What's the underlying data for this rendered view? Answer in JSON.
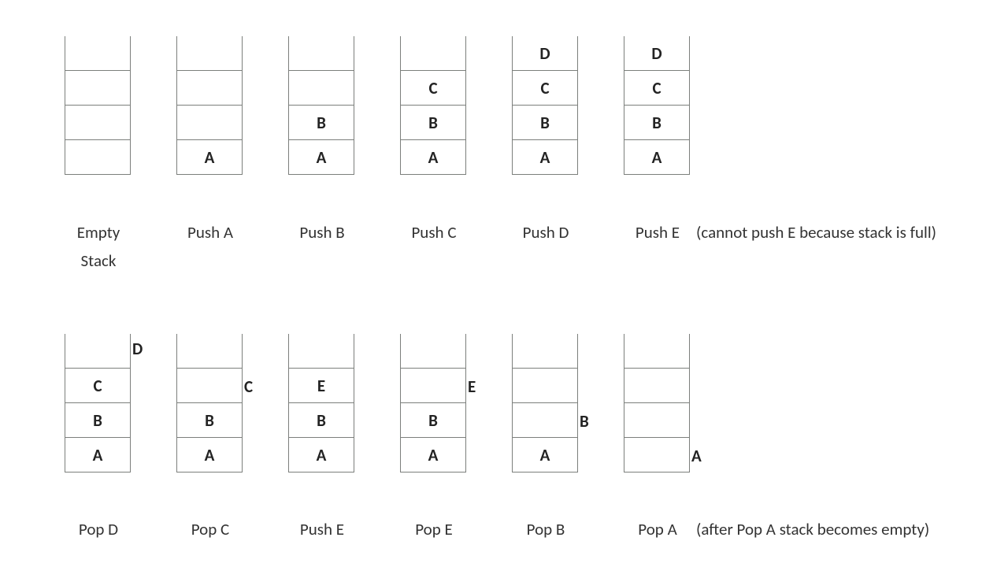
{
  "capacity": 4,
  "top_row": [
    {
      "label": "Empty Stack",
      "values": [
        "",
        "",
        "",
        ""
      ],
      "popped": null
    },
    {
      "label": "Push A",
      "values": [
        "",
        "",
        "",
        "A"
      ],
      "popped": null
    },
    {
      "label": "Push B",
      "values": [
        "",
        "",
        "B",
        "A"
      ],
      "popped": null
    },
    {
      "label": "Push C",
      "values": [
        "",
        "C",
        "B",
        "A"
      ],
      "popped": null
    },
    {
      "label": "Push D",
      "values": [
        "D",
        "C",
        "B",
        "A"
      ],
      "popped": null
    },
    {
      "label": "Push E",
      "values": [
        "D",
        "C",
        "B",
        "A"
      ],
      "popped": null,
      "extra": "(cannot push E because stack is full)"
    }
  ],
  "bottom_row": [
    {
      "label": "Pop D",
      "values": [
        "",
        "C",
        "B",
        "A"
      ],
      "popped": "D",
      "pop_slot": 0
    },
    {
      "label": "Pop C",
      "values": [
        "",
        "",
        "B",
        "A"
      ],
      "popped": "C",
      "pop_slot": 1
    },
    {
      "label": "Push E",
      "values": [
        "",
        "E",
        "B",
        "A"
      ],
      "popped": null
    },
    {
      "label": "Pop E",
      "values": [
        "",
        "",
        "B",
        "A"
      ],
      "popped": "E",
      "pop_slot": 1
    },
    {
      "label": "Pop B",
      "values": [
        "",
        "",
        "",
        "A"
      ],
      "popped": "B",
      "pop_slot": 2
    },
    {
      "label": "Pop A",
      "values": [
        "",
        "",
        "",
        ""
      ],
      "popped": "A",
      "pop_slot": 3,
      "extra": "(after Pop A stack becomes empty)"
    }
  ]
}
